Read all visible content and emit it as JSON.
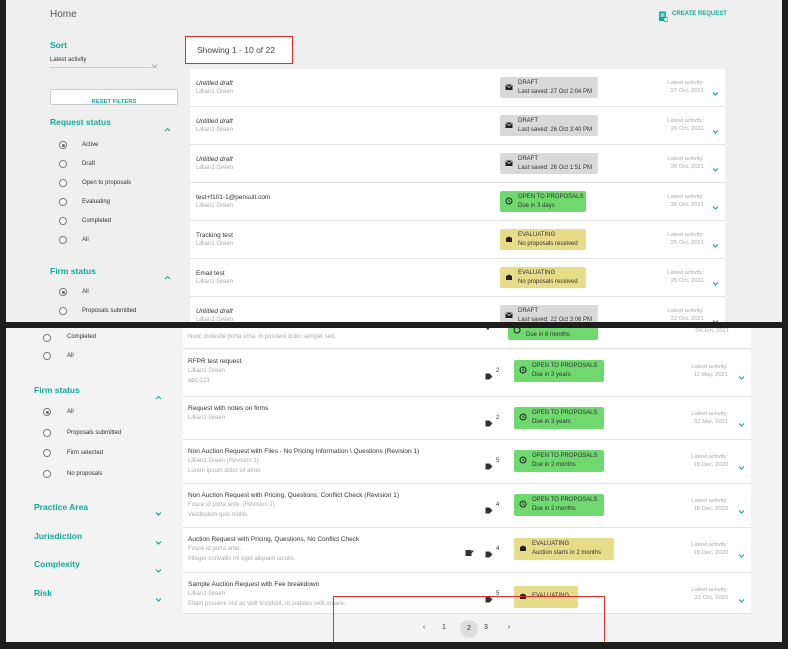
{
  "top": {
    "title": "Home",
    "create_request": "CREATE REQUEST",
    "sort_label": "Sort",
    "sort_value": "Latest activity",
    "reset_filters": "RESET FILTERS",
    "request_status_title": "Request status",
    "request_status_options": [
      "Active",
      "Draft",
      "Open to proposals",
      "Evaluating",
      "Completed",
      "All"
    ],
    "firm_status_title": "Firm status",
    "firm_status_options": [
      "All",
      "Proposals submitted"
    ],
    "showing": "Showing 1 - 10 of 22",
    "rows": [
      {
        "title": "Untitled draft",
        "client": "Lillian1 Green",
        "status": "DRAFT",
        "status_sub": "Last saved: 27 Oct 2:04 PM",
        "kind": "draft",
        "la_label": "Latest activity:",
        "la_date": "27 Oct, 2021"
      },
      {
        "title": "Untitled draft",
        "client": "Lillian1 Green",
        "status": "DRAFT",
        "status_sub": "Last saved: 26 Oct 3:40 PM",
        "kind": "draft",
        "la_label": "Latest activity:",
        "la_date": "26 Oct, 2021"
      },
      {
        "title": "Untitled draft",
        "client": "Lillian1 Green",
        "status": "DRAFT",
        "status_sub": "Last saved: 26 Oct 1:51 PM",
        "kind": "draft",
        "la_label": "Latest activity:",
        "la_date": "26 Oct, 2021"
      },
      {
        "title": "test+f101-1@pensult.com",
        "client": "Lillian1 Green",
        "status": "OPEN TO PROPOSALS",
        "status_sub": "Due in 3 days",
        "kind": "open",
        "la_label": "Latest activity:",
        "la_date": "26 Oct, 2021"
      },
      {
        "title": "Tracking test",
        "client": "Lillian1 Green",
        "status": "EVALUATING",
        "status_sub": "No proposals received",
        "kind": "eval",
        "la_label": "Latest activity:",
        "la_date": "25 Oct, 2021"
      },
      {
        "title": "Email test",
        "client": "Lillian1 Green",
        "status": "EVALUATING",
        "status_sub": "No proposals received",
        "kind": "eval",
        "la_label": "Latest activity:",
        "la_date": "25 Oct, 2021"
      },
      {
        "title": "Untitled draft",
        "client": "Lillian1 Green",
        "status": "DRAFT",
        "status_sub": "Last saved: 22 Oct 3:06 PM",
        "kind": "draft",
        "la_label": "Latest activity:",
        "la_date": "22 Oct, 2021"
      }
    ]
  },
  "bottom": {
    "completed_label": "Completed",
    "all_label": "All",
    "firm_status_title": "Firm status",
    "firm_status_options": [
      "All",
      "Proposals submitted",
      "Firm selected",
      "No proposals"
    ],
    "filters": [
      "Practice Area",
      "Jurisdiction",
      "Complexity",
      "Risk"
    ],
    "partial_row": {
      "desc": "Nunc molestie porta urna, in posuere dolor semper sed.",
      "status_sub": "Due in 8 months",
      "la_date": "04 Jun, 2021"
    },
    "rows": [
      {
        "title": "RFPR test request",
        "lines": [
          "Lillian1 Green",
          "abc-123"
        ],
        "tags": "2",
        "status": "OPEN TO PROPOSALS",
        "status_sub": "Due in 3 years",
        "kind": "open",
        "la_label": "Latest activity:",
        "la_date": "11 May, 2021"
      },
      {
        "title": "Request with notes on firms",
        "lines": [
          "Lillian1 Green"
        ],
        "tags": "2",
        "status": "OPEN TO PROPOSALS",
        "status_sub": "Due in 3 years",
        "kind": "open",
        "la_label": "Latest activity:",
        "la_date": "02 Mar, 2021"
      },
      {
        "title": "Non Auction Request with Files - No Pricing Information \\ Questions (Revision 1)",
        "lines": [
          "Lillian1 Green (Revision 1)",
          "Lorem ipsum dolor sit amet"
        ],
        "tags": "5",
        "status": "OPEN TO PROPOSALS",
        "status_sub": "Due in 2 months",
        "kind": "open",
        "la_label": "Latest activity:",
        "la_date": "18 Dec, 2020"
      },
      {
        "title": "Non Auction Request with Pricing, Questions, Conflict Check (Revision 1)",
        "lines": [
          "Fusce id porta ante. (Revision 1)",
          "Vestibulum quis mollis"
        ],
        "tags": "4",
        "status": "OPEN TO PROPOSALS",
        "status_sub": "Due in 2 months",
        "kind": "open",
        "la_label": "Latest activity:",
        "la_date": "18 Dec, 2020"
      },
      {
        "title": "Auction Request with Pricing, Questions, No Conflict Check",
        "lines": [
          "Fusce id porta ante.",
          "Integer convallis mi eget aliquam iaculis."
        ],
        "tags": "4",
        "status": "EVALUATING",
        "status_sub": "Auction starts in 2 months",
        "kind": "eval",
        "la_label": "Latest activity:",
        "la_date": "18 Dec, 2020"
      },
      {
        "title": "Sample Auction Request with Fee breakdown",
        "lines": [
          "Lillian1 Green",
          "Etiam posuere nisl ac velit tincidunt, ut sodales velit ornare."
        ],
        "tags": "5",
        "status": "EVALUATING",
        "status_sub": "",
        "kind": "eval",
        "la_label": "Latest activity:",
        "la_date": "22 Oct, 2020"
      }
    ],
    "pages": [
      "1",
      "2",
      "3"
    ],
    "current_page": "2"
  },
  "colors": {
    "accent": "#14a89a",
    "open": "#6fd86f",
    "evaluating": "#e6dc8a",
    "draft": "#d9d9d9",
    "highlight": "#e0302e"
  }
}
